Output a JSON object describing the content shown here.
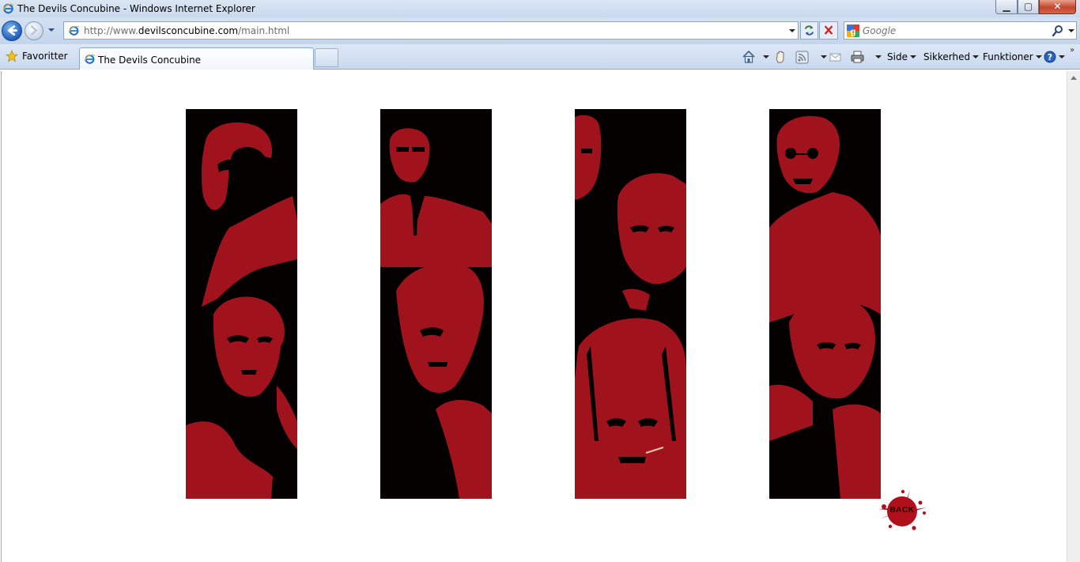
{
  "window": {
    "title": "The Devils Concubine - Windows Internet Explorer",
    "minimize_glyph": "▁",
    "maximize_glyph": "▢",
    "close_glyph": "✕"
  },
  "address_bar": {
    "url_prefix": "http://www.",
    "url_domain": "devilsconcubine.com",
    "url_path": "/main.html"
  },
  "search": {
    "placeholder": "Google"
  },
  "tabs": {
    "favorites_label": "Favoritter",
    "active_tab_label": "The Devils Concubine"
  },
  "command_bar": {
    "page_label": "Side",
    "safety_label": "Sikkerhed",
    "tools_label": "Funktioner"
  },
  "page": {
    "back_label": "BACK",
    "accent_color": "#a0131c",
    "panel_color": "#050000"
  },
  "icons": [
    "ie-icon",
    "back-arrow-icon",
    "forward-arrow-icon",
    "page-icon",
    "refresh-icon",
    "stop-icon",
    "google-icon",
    "search-icon",
    "star-icon",
    "home-icon",
    "hand-icon",
    "rss-icon",
    "mail-icon",
    "print-icon",
    "help-icon"
  ]
}
